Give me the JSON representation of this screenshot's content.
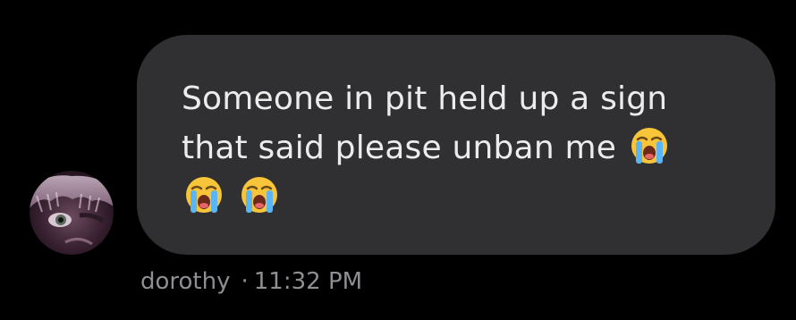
{
  "message": {
    "line1": "Someone in pit held up a sign",
    "line2": "that said please unban me",
    "emojis": [
      "loudly-crying-face-icon",
      "loudly-crying-face-icon",
      "loudly-crying-face-icon"
    ]
  },
  "sender": {
    "name": "dorothy",
    "separator": "·",
    "time": "11:32 PM"
  },
  "colors": {
    "background": "#000000",
    "bubble": "#303033",
    "text": "#ECECEC",
    "meta": "#8E8E93"
  }
}
